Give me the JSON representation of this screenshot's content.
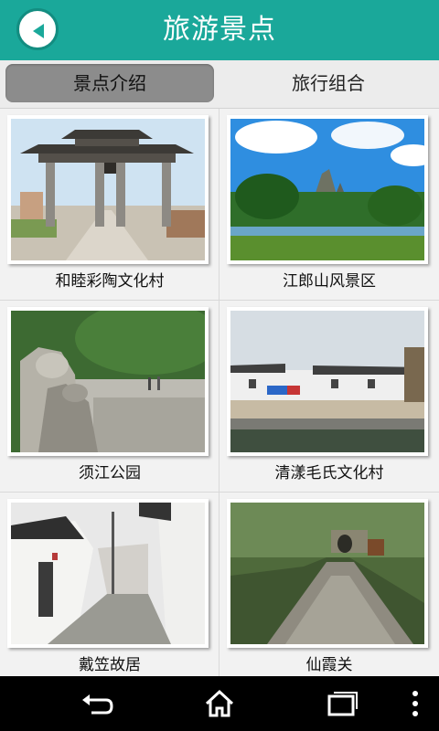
{
  "header": {
    "title": "旅游景点",
    "back_icon": "back-arrow-icon"
  },
  "tabs": [
    {
      "label": "景点介绍",
      "active": true
    },
    {
      "label": "旅行组合",
      "active": false
    }
  ],
  "attractions": [
    {
      "name": "和睦彩陶文化村",
      "image": "traditional-archway-gate-photo"
    },
    {
      "name": "江郎山风景区",
      "image": "mountain-landscape-photo"
    },
    {
      "name": "须江公园",
      "image": "rock-garden-park-photo"
    },
    {
      "name": "清漾毛氏文化村",
      "image": "white-wall-village-photo"
    },
    {
      "name": "戴笠故居",
      "image": "old-lane-houses-photo"
    },
    {
      "name": "仙霞关",
      "image": "ancient-stone-path-photo"
    }
  ],
  "colors": {
    "header": "#1aa89a",
    "active_tab": "#8c8c8c",
    "background": "#f2f2f2",
    "navbar": "#000000"
  },
  "navbar": {
    "icons": [
      "back-icon",
      "home-icon",
      "recent-apps-icon",
      "menu-dots-icon"
    ]
  }
}
